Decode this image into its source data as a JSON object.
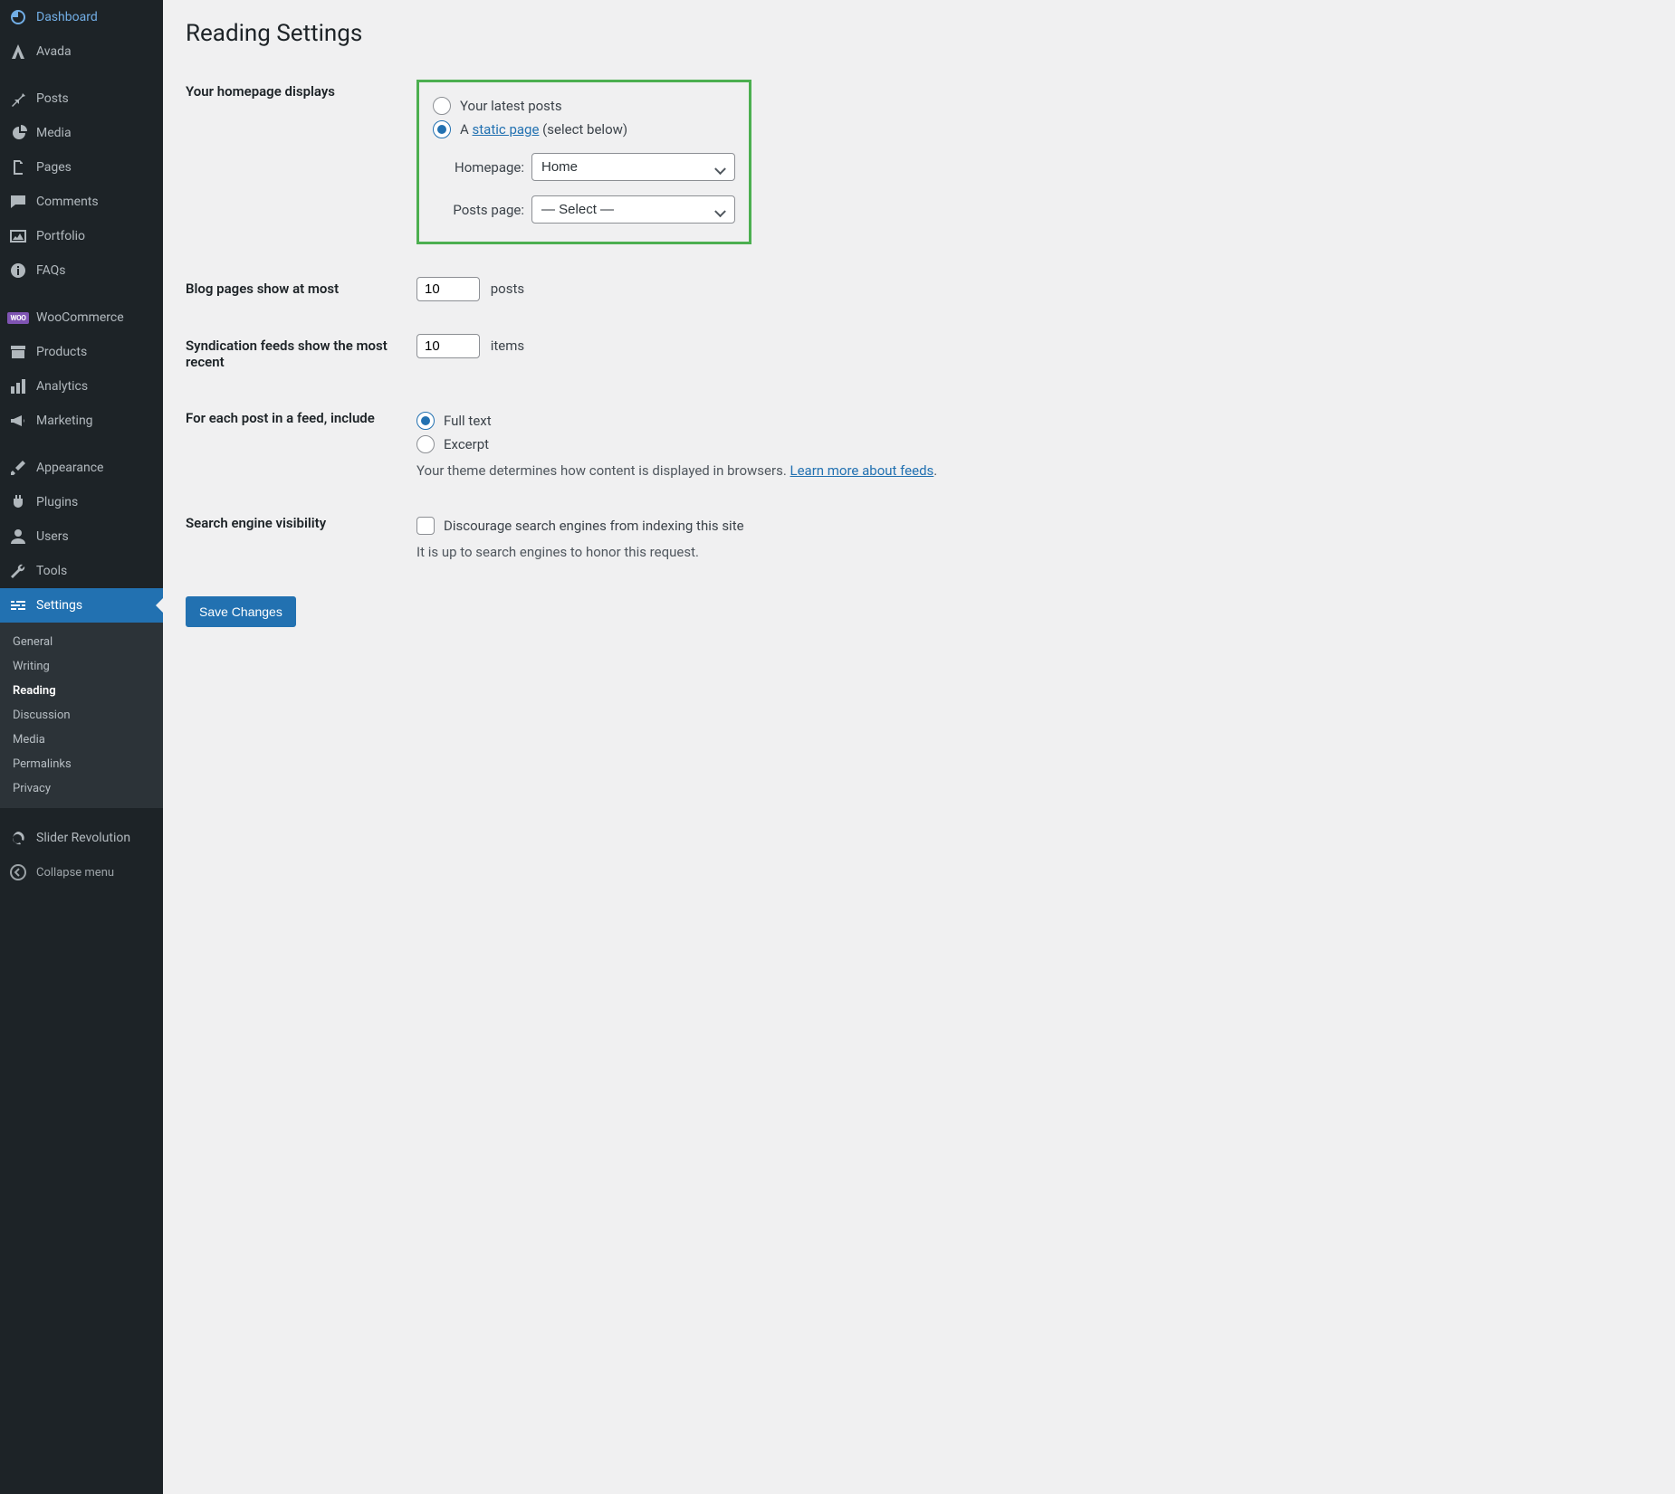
{
  "sidebar": {
    "items": [
      {
        "label": "Dashboard",
        "icon": "dashboard"
      },
      {
        "label": "Avada",
        "icon": "avada"
      },
      {
        "label": "Posts",
        "icon": "pin"
      },
      {
        "label": "Media",
        "icon": "media"
      },
      {
        "label": "Pages",
        "icon": "pages"
      },
      {
        "label": "Comments",
        "icon": "comments"
      },
      {
        "label": "Portfolio",
        "icon": "portfolio"
      },
      {
        "label": "FAQs",
        "icon": "faqs"
      },
      {
        "label": "WooCommerce",
        "icon": "woo"
      },
      {
        "label": "Products",
        "icon": "products"
      },
      {
        "label": "Analytics",
        "icon": "analytics"
      },
      {
        "label": "Marketing",
        "icon": "marketing"
      },
      {
        "label": "Appearance",
        "icon": "appearance"
      },
      {
        "label": "Plugins",
        "icon": "plugins"
      },
      {
        "label": "Users",
        "icon": "users"
      },
      {
        "label": "Tools",
        "icon": "tools"
      },
      {
        "label": "Settings",
        "icon": "settings",
        "active": true
      }
    ],
    "sub": {
      "general": "General",
      "writing": "Writing",
      "reading": "Reading",
      "discussion": "Discussion",
      "media": "Media",
      "permalinks": "Permalinks",
      "privacy": "Privacy"
    },
    "slider": "Slider Revolution",
    "collapse": "Collapse menu"
  },
  "page": {
    "title": "Reading Settings",
    "homepage_label": "Your homepage displays",
    "opt_latest": "Your latest posts",
    "opt_static_prefix": "A ",
    "opt_static_link": "static page",
    "opt_static_suffix": " (select below)",
    "homepage_select_label": "Homepage:",
    "homepage_select_value": "Home",
    "posts_select_label": "Posts page:",
    "posts_select_value": "— Select —",
    "blog_pages_label": "Blog pages show at most",
    "blog_pages_value": "10",
    "blog_pages_unit": "posts",
    "syndication_label": "Syndication feeds show the most recent",
    "syndication_value": "10",
    "syndication_unit": "items",
    "feed_label": "For each post in a feed, include",
    "feed_full": "Full text",
    "feed_excerpt": "Excerpt",
    "feed_desc_prefix": "Your theme determines how content is displayed in browsers. ",
    "feed_desc_link": "Learn more about feeds",
    "search_label": "Search engine visibility",
    "search_checkbox": "Discourage search engines from indexing this site",
    "search_desc": "It is up to search engines to honor this request.",
    "save": "Save Changes"
  }
}
